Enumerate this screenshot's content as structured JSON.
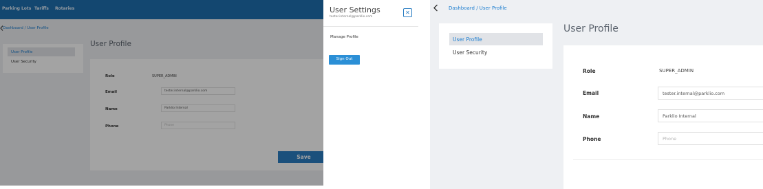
{
  "nav": {
    "items": [
      "Parking Lots",
      "Tariffs",
      "Rotaries"
    ]
  },
  "breadcrumb": "Dashboard / User Profile",
  "sidebar": {
    "items": [
      "User Profile",
      "User Security"
    ],
    "selected": "User Profile"
  },
  "profile": {
    "title": "User Profile",
    "fields": {
      "role_label": "Role",
      "role_value": "SUPER_ADMIN",
      "email_label": "Email",
      "email_value": "tester.internal@parklio.com",
      "name_label": "Name",
      "name_value": "Parklio Internal",
      "phone_label": "Phone",
      "phone_placeholder": "Phone"
    },
    "save_label": "Save"
  },
  "drawer": {
    "title": "User Settings",
    "email": "tester.internal@parklio.com",
    "close_glyph": "✕",
    "manage_label": "Manage Profile",
    "signout_label": "Sign Out"
  },
  "colors": {
    "brand_blue": "#1f6fb0",
    "accent_blue": "#2b7ec3",
    "link_blue": "#1f7fd0"
  },
  "icons": [
    "chevron-left-icon",
    "close-icon"
  ]
}
